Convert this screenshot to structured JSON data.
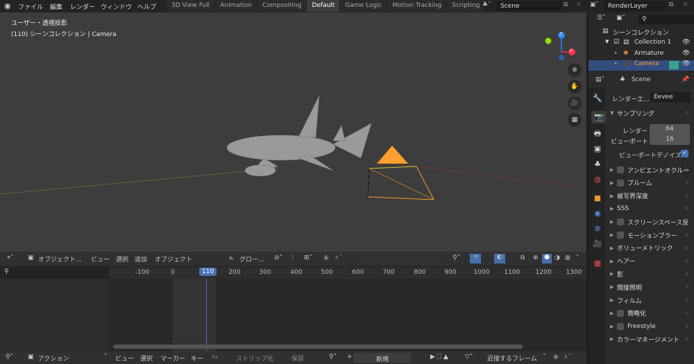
{
  "topbar": {
    "menus": [
      "ファイル",
      "編集",
      "レンダー",
      "ウィンドウ",
      "ヘルプ"
    ],
    "workspaces": [
      "3D View Full",
      "Animation",
      "Compositing",
      "Default",
      "Game Logic",
      "Motion Tracking",
      "Scripting"
    ],
    "active_workspace": "Default",
    "scene": "Scene",
    "view_layer": "RenderLayer"
  },
  "viewport": {
    "view_name": "ユーザー・透視投影",
    "info": "(110) シーンコレクション | Camera",
    "gizmo": {
      "z": "Z",
      "x": "X"
    },
    "header": {
      "mode": "オブジェクト...",
      "menus": [
        "ビュー",
        "選択",
        "追加",
        "オブジェクト"
      ],
      "orientation": "グロー..."
    }
  },
  "timeline": {
    "ticks": [
      "-100",
      "0",
      "110",
      "200",
      "300",
      "400",
      "500",
      "600",
      "700",
      "800",
      "900",
      "1000",
      "1100",
      "1200",
      "1300"
    ],
    "current_frame": "110",
    "header": {
      "mode": "アクション",
      "menus": [
        "ビュー",
        "選択",
        "マーカー",
        "キー"
      ],
      "push_down": "ストリップ化",
      "stash": "保留",
      "new": "新規",
      "snap": "近接するフレーム"
    }
  },
  "outliner": {
    "root": "シーンコレクション",
    "items": [
      "Collection 1",
      "Armature",
      "Camera"
    ],
    "selected": "Camera"
  },
  "properties": {
    "context": "Scene",
    "engine_label": "レンダーエ...",
    "engine": "Eevee",
    "sampling": {
      "title": "サンプリング",
      "render_label": "レンダー",
      "render": "64",
      "viewport_label": "ビューポート",
      "viewport": "16",
      "denoise": "ビューポートデノイズ",
      "denoise_checked": true
    },
    "panels": [
      {
        "label": "アンビエントオクルー",
        "checkbox": true
      },
      {
        "label": "ブルーム",
        "checkbox": true
      },
      {
        "label": "被写界深度",
        "checkbox": false
      },
      {
        "label": "SSS",
        "checkbox": false
      },
      {
        "label": "スクリーンスペース反",
        "checkbox": true
      },
      {
        "label": "モーションブラー",
        "checkbox": true
      },
      {
        "label": "ボリューメトリック",
        "checkbox": false
      },
      {
        "label": "ヘアー",
        "checkbox": false
      },
      {
        "label": "影",
        "checkbox": false
      },
      {
        "label": "間接照明",
        "checkbox": false
      },
      {
        "label": "フィルム",
        "checkbox": false
      },
      {
        "label": "簡略化",
        "checkbox": true
      },
      {
        "label": "Freestyle",
        "checkbox": true
      },
      {
        "label": "カラーマネージメント",
        "checkbox": false
      }
    ]
  },
  "colors": {
    "accent": "#4772b3",
    "selected_row": "#334d80",
    "camera": "#ffa030",
    "x_axis": "#ff3352",
    "y_axis": "#8bdc00",
    "z_axis": "#2f85ff"
  }
}
